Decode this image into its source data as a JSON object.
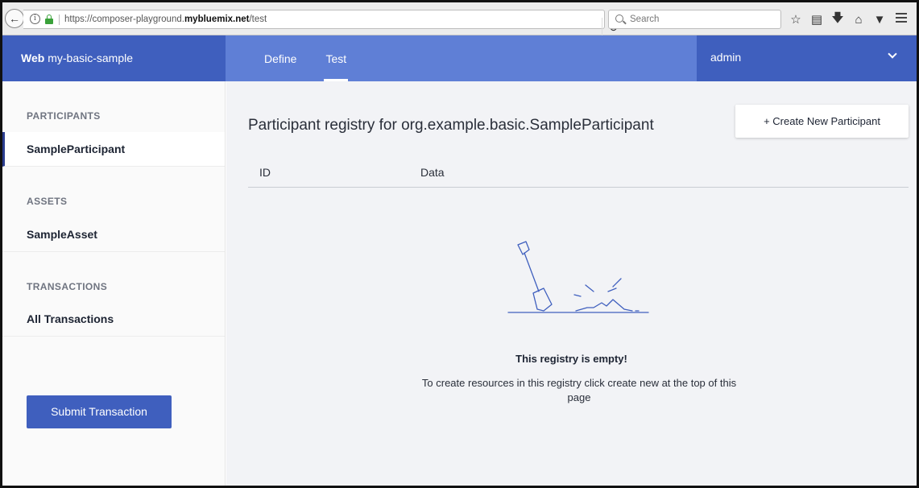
{
  "browser": {
    "url_prefix": "https://composer-playground.",
    "url_domain": "mybluemix.net",
    "url_path": "/test",
    "search_placeholder": "Search"
  },
  "app": {
    "brand_bold": "Web",
    "brand_name": "my-basic-sample",
    "tabs": [
      {
        "label": "Define",
        "active": false
      },
      {
        "label": "Test",
        "active": true
      }
    ],
    "user": "admin"
  },
  "sidebar": {
    "participants_heading": "PARTICIPANTS",
    "participants": [
      "SampleParticipant"
    ],
    "assets_heading": "ASSETS",
    "assets": [
      "SampleAsset"
    ],
    "transactions_heading": "TRANSACTIONS",
    "transactions": [
      "All Transactions"
    ],
    "submit_label": "Submit Transaction"
  },
  "main": {
    "title": "Participant registry for org.example.basic.SampleParticipant",
    "create_label": "+ Create New Participant",
    "columns": [
      "ID",
      "Data"
    ],
    "empty_title": "This registry is empty!",
    "empty_message": "To create resources in this registry click create new at the top of this page"
  },
  "colors": {
    "header": "#5f7fd6",
    "header_dark": "#3f5fbe",
    "main_bg": "#f2f3f6",
    "illustration": "#3f5fbe"
  }
}
